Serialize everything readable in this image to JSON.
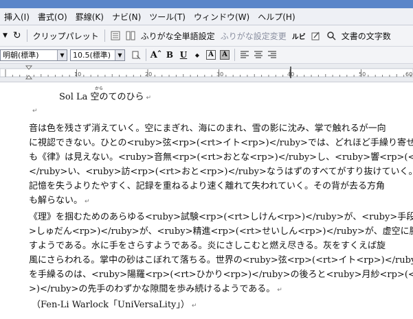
{
  "menu": {
    "items": [
      "挿入(I)",
      "書式(O)",
      "罫線(K)",
      "ナビ(N)",
      "ツール(T)",
      "ウィンドウ(W)",
      "ヘルプ(H)"
    ]
  },
  "toolbar1": {
    "clip_palette": "クリップパレット",
    "furigana_all": "ふりがな全単語設定",
    "furigana_change": "ふりがな設定変更",
    "ruby": "ルビ",
    "char_count": "文書の文字数"
  },
  "toolbar2": {
    "font_name": "明朝(標準)",
    "font_size": "10.5(標準)",
    "bold": "B",
    "underline": "U",
    "a_boxed": "A",
    "a_shaded": "A"
  },
  "ruler": {
    "labels": [
      "10",
      "20",
      "30",
      "40",
      "50",
      "60"
    ]
  },
  "document": {
    "heading": "Sol La 空のてのひら",
    "heading_ruby": "から",
    "paragraph_mark": "↵",
    "lines": [
      "音は色を残さず消えていく。空にまぎれ、海にのまれ、雪の影に沈み、掌で触れるが一向",
      "に視認できない。ひとの<ruby>弦<rp>(<rt>イト<rp>)</ruby>では、どれほど手繰り寄せて",
      "も《律》は見えない。<ruby>音無<rp>(<rt>おとな<rp>)</ruby>し、<ruby>響<rp>(<rt>おとな",
      "</ruby>い、<ruby>訪<rp>(<rt>おと<rp>)</ruby>なうはずのすべてがすり抜けていく。",
      "記憶を失うよりたやすく、記録を重ねるより速く離れて失われていく。その背が去る方角",
      "も解らない。",
      "《理》を掴むためのあらゆる<ruby>試験<rp>(<rt>しけん<rp>)</ruby>が、<ruby>手段<rp>(<rt",
      ">しゅだん<rp>)</ruby>が、<ruby>精進<rp>(<rt>せいしん<rp>)</ruby>が、虚空に腕を伸ば",
      "すようである。水に手をさらすようである。炎にさしこむと燃え尽きる。灰をすくえば旋",
      "風にさらわれる。掌中の砂はこぼれて落ちる。世界の<ruby>弦<rp>(<rt>イト<rp>)</ruby>",
      "を手繰るのは、<ruby>陽羅<rp>(<rt>ひかり<rp>)</ruby>の後ろと<ruby>月紗<rp>(<rt>ひかり",
      ">)</ruby>の先手のわずかな隙間を歩み続けるようである。",
      "（Fen-Li Warlock「UniVersaLity」）"
    ]
  }
}
